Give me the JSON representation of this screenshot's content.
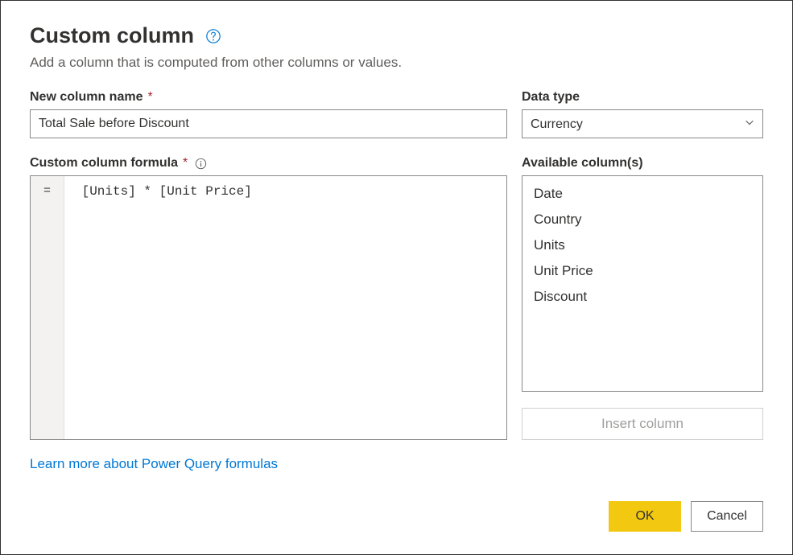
{
  "dialog": {
    "title": "Custom column",
    "subtitle": "Add a column that is computed from other columns or values."
  },
  "fields": {
    "new_column_name_label": "New column name",
    "new_column_name_value": "Total Sale before Discount",
    "data_type_label": "Data type",
    "data_type_value": "Currency",
    "formula_label": "Custom column formula",
    "formula_prefix": "=",
    "formula_value": " [Units] * [Unit Price]",
    "available_columns_label": "Available column(s)",
    "available_columns": [
      "Date",
      "Country",
      "Units",
      "Unit Price",
      "Discount"
    ]
  },
  "actions": {
    "insert_column": "Insert column",
    "learn_more": "Learn more about Power Query formulas",
    "ok": "OK",
    "cancel": "Cancel"
  }
}
